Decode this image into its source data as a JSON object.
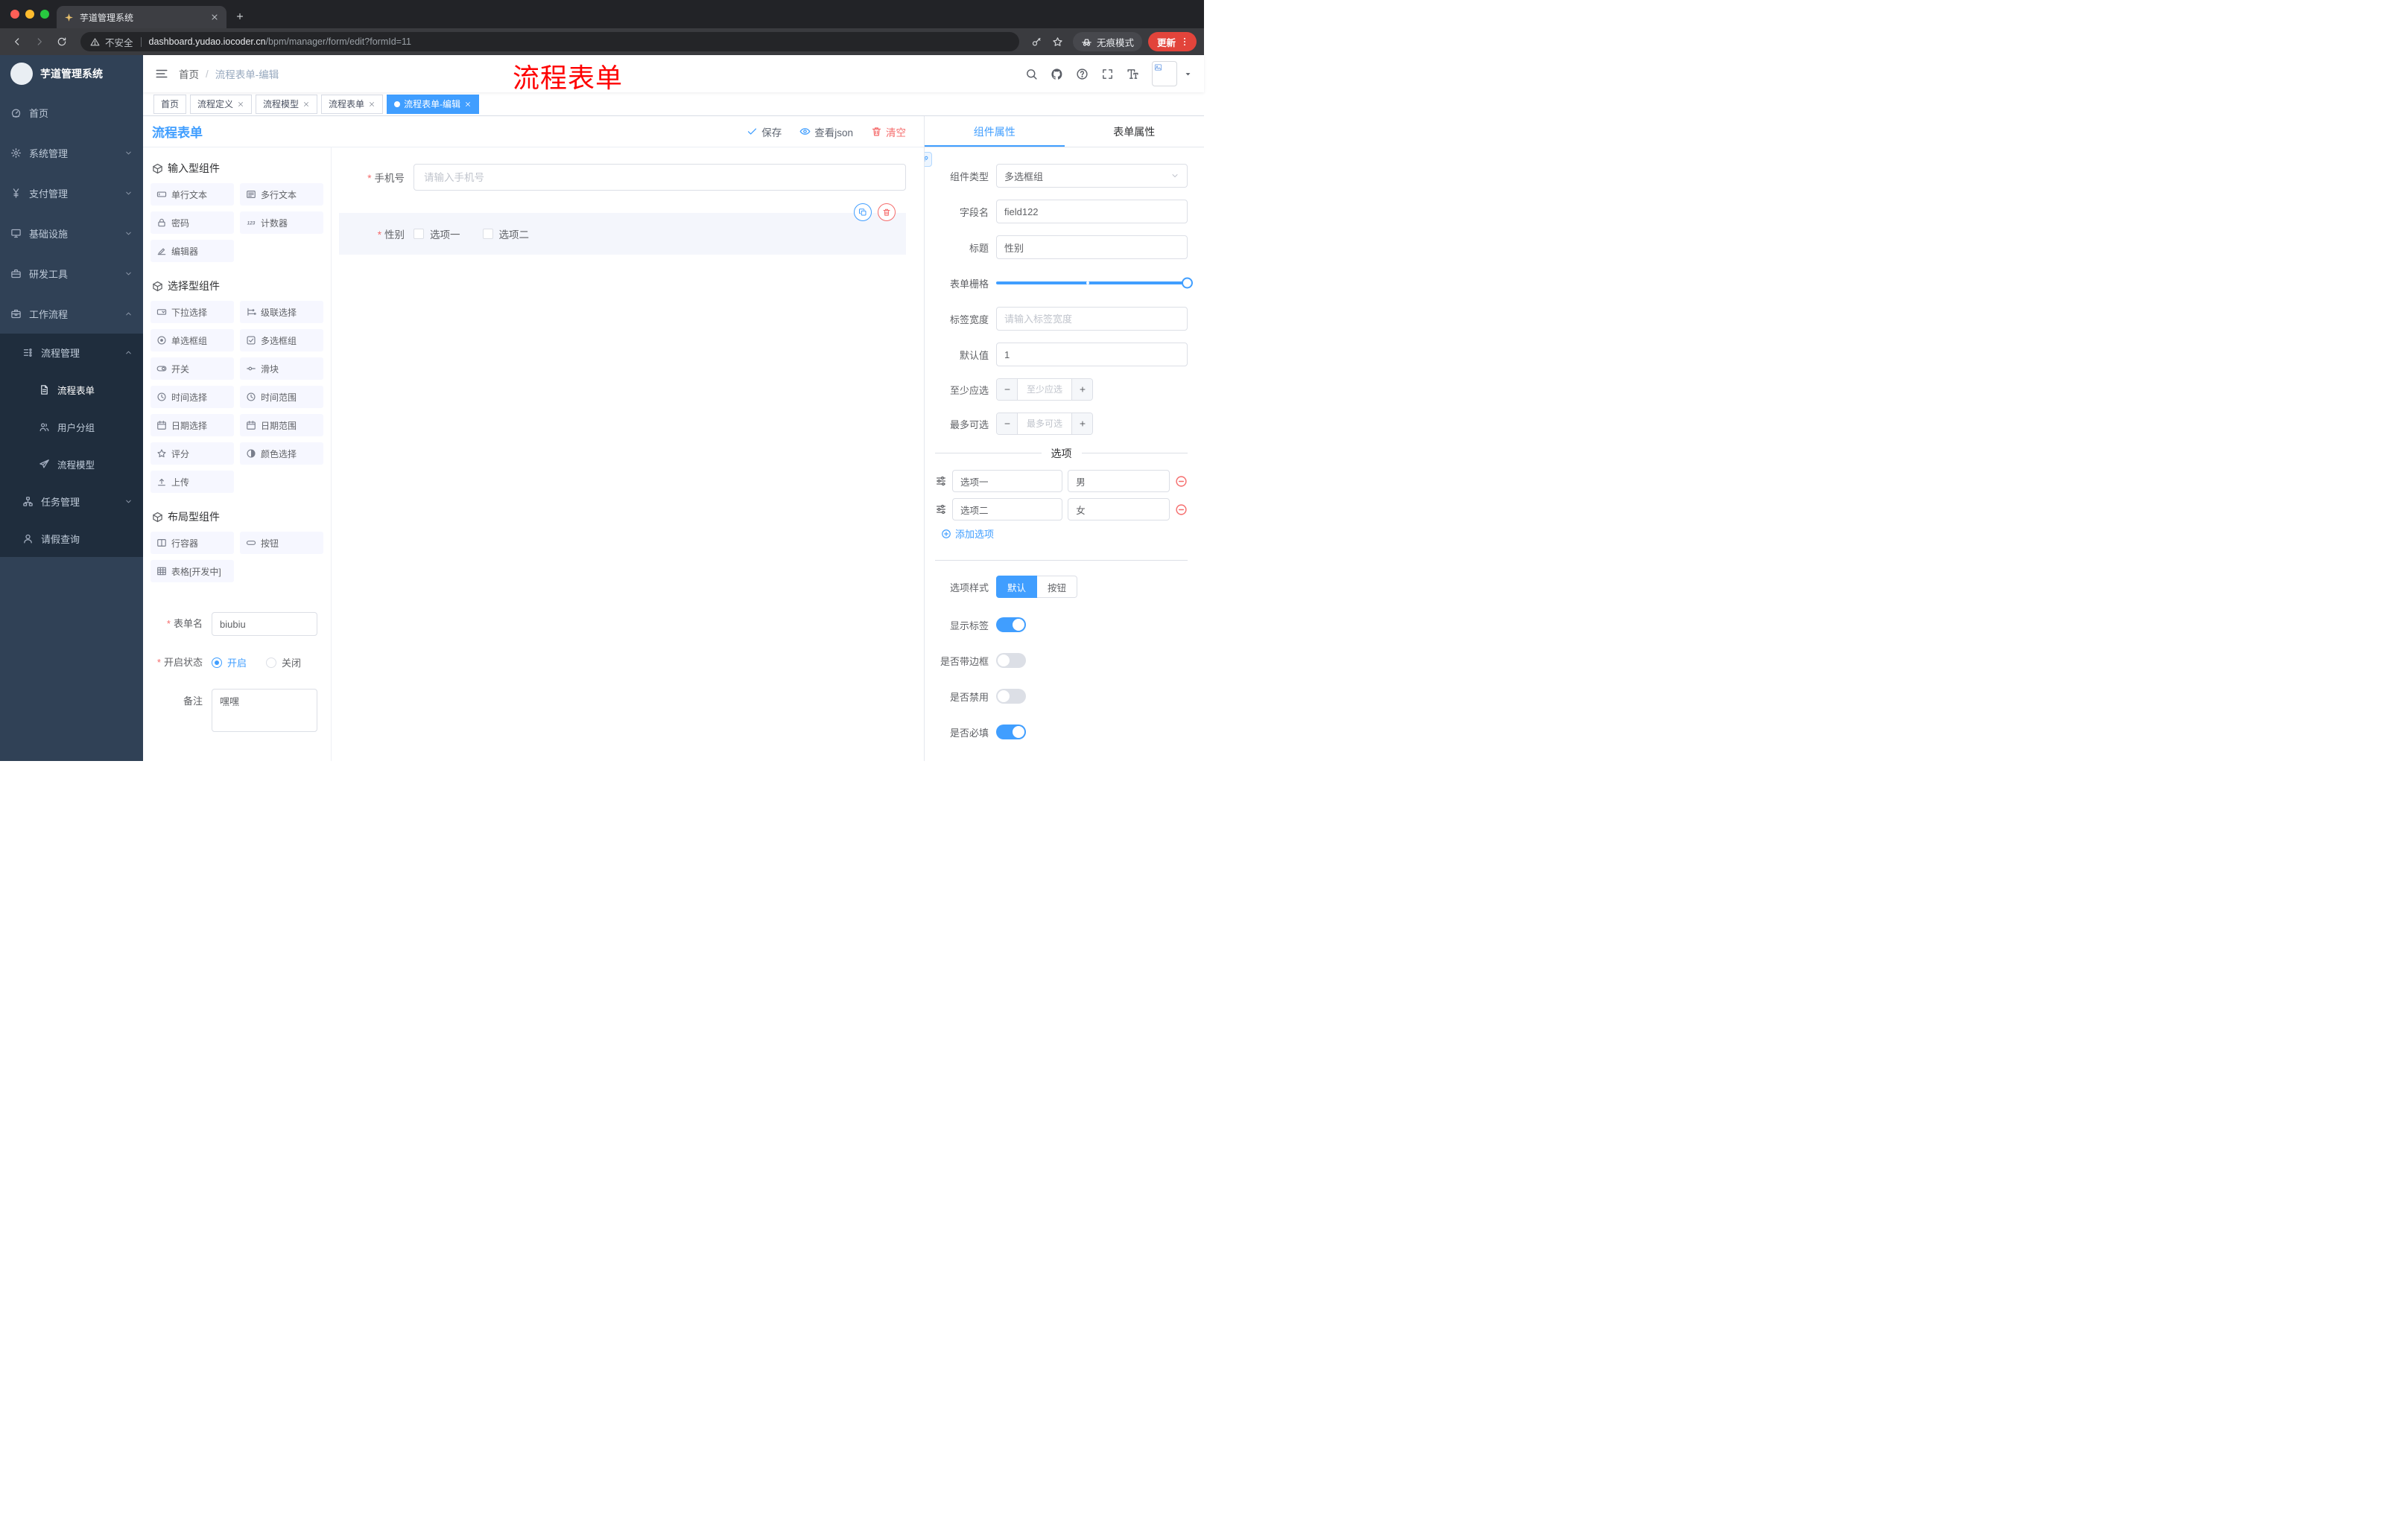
{
  "theme": {
    "primary": "#409eff",
    "danger": "#f56c6c",
    "active_tag": "#409eff",
    "annotation_color": "#ff0000",
    "sidebar_bg": "#304156",
    "submenu_bg": "#1f2d3d"
  },
  "browser": {
    "tab_title": "芋道管理系统",
    "url_security": "不安全",
    "url_host": "dashboard.yudao.iocoder.cn",
    "url_path": "/bpm/manager/form/edit?formId=11",
    "incognito_label": "无痕模式",
    "update_label": "更新",
    "icons": [
      "back",
      "forward",
      "reload",
      "warning",
      "key",
      "star",
      "incognito",
      "kebab-menu"
    ]
  },
  "sidebar": {
    "brand": "芋道管理系统",
    "items": [
      {
        "label": "首页",
        "icon": "dashboard",
        "level": 1
      },
      {
        "label": "系统管理",
        "icon": "gear",
        "level": 1,
        "arrow": "down"
      },
      {
        "label": "支付管理",
        "icon": "yen",
        "level": 1,
        "arrow": "down"
      },
      {
        "label": "基础设施",
        "icon": "monitor",
        "level": 1,
        "arrow": "down"
      },
      {
        "label": "研发工具",
        "icon": "toolbox",
        "level": 1,
        "arrow": "down"
      },
      {
        "label": "工作流程",
        "icon": "briefcase",
        "level": 1,
        "arrow": "up",
        "expanded": true
      },
      {
        "label": "流程管理",
        "icon": "tree",
        "level": 2,
        "arrow": "up",
        "expanded": true
      },
      {
        "label": "流程表单",
        "icon": "document",
        "level": 3,
        "active": true
      },
      {
        "label": "用户分组",
        "icon": "people",
        "level": 3
      },
      {
        "label": "流程模型",
        "icon": "send",
        "level": 3
      },
      {
        "label": "任务管理",
        "icon": "nodes",
        "level": 2,
        "arrow": "down"
      },
      {
        "label": "请假查询",
        "icon": "user",
        "level": 2
      }
    ]
  },
  "header": {
    "breadcrumb": [
      "首页",
      "流程表单-编辑"
    ],
    "breadcrumb_separator": "/",
    "annotation": "流程表单",
    "right_icons": [
      "search",
      "github",
      "help",
      "fullscreen",
      "font-size",
      "avatar",
      "caret-down"
    ]
  },
  "tags": [
    {
      "label": "首页",
      "closable": false,
      "active": false
    },
    {
      "label": "流程定义",
      "closable": true,
      "active": false
    },
    {
      "label": "流程模型",
      "closable": true,
      "active": false
    },
    {
      "label": "流程表单",
      "closable": true,
      "active": false
    },
    {
      "label": "流程表单-编辑",
      "closable": true,
      "active": true
    }
  ],
  "designer": {
    "title": "流程表单",
    "actions": {
      "save": "保存",
      "view_json": "查看json",
      "clear": "清空"
    },
    "palette": {
      "sections": [
        {
          "title": "输入型组件",
          "items": [
            {
              "label": "单行文本",
              "icon": "field-input"
            },
            {
              "label": "多行文本",
              "icon": "field-textarea"
            },
            {
              "label": "密码",
              "icon": "lock"
            },
            {
              "label": "计数器",
              "icon": "number123"
            },
            {
              "label": "编辑器",
              "icon": "pencil"
            }
          ]
        },
        {
          "title": "选择型组件",
          "items": [
            {
              "label": "下拉选择",
              "icon": "select-box"
            },
            {
              "label": "级联选择",
              "icon": "cascader"
            },
            {
              "label": "单选框组",
              "icon": "radio-icon"
            },
            {
              "label": "多选框组",
              "icon": "checkbox-icon"
            },
            {
              "label": "开关",
              "icon": "switch-icon"
            },
            {
              "label": "滑块",
              "icon": "slider-icon"
            },
            {
              "label": "时间选择",
              "icon": "clock"
            },
            {
              "label": "时间范围",
              "icon": "clock"
            },
            {
              "label": "日期选择",
              "icon": "calendar"
            },
            {
              "label": "日期范围",
              "icon": "calendar"
            },
            {
              "label": "评分",
              "icon": "star-o"
            },
            {
              "label": "颜色选择",
              "icon": "color-wheel"
            },
            {
              "label": "上传",
              "icon": "upload"
            }
          ]
        },
        {
          "title": "布局型组件",
          "items": [
            {
              "label": "行容器",
              "icon": "row-layout"
            },
            {
              "label": "按钮",
              "icon": "button-icon"
            },
            {
              "label": "表格[开发中]",
              "icon": "table-grid"
            }
          ]
        }
      ]
    },
    "form_meta": {
      "name_label": "表单名",
      "name_value": "biubiu",
      "status_label": "开启状态",
      "status_options": [
        "开启",
        "关闭"
      ],
      "status_selected": "开启",
      "remark_label": "备注",
      "remark_value": "嘿嘿"
    },
    "canvas": {
      "phone": {
        "label": "手机号",
        "required": true,
        "placeholder": "请输入手机号"
      },
      "gender": {
        "label": "性别",
        "required": true,
        "options": [
          "选项一",
          "选项二"
        ],
        "checked": [
          false,
          false
        ]
      }
    }
  },
  "inspector": {
    "tabs": [
      "组件属性",
      "表单属性"
    ],
    "active_tab": "组件属性",
    "rows": {
      "component_type": {
        "label": "组件类型",
        "value": "多选框组"
      },
      "field_name": {
        "label": "字段名",
        "value": "field122"
      },
      "title": {
        "label": "标题",
        "value": "性别"
      },
      "grid": {
        "label": "表单栅格"
      },
      "label_width": {
        "label": "标签宽度",
        "placeholder": "请输入标签宽度"
      },
      "default_value": {
        "label": "默认值",
        "value": "1"
      },
      "min_select": {
        "label": "至少应选",
        "placeholder": "至少应选"
      },
      "max_select": {
        "label": "最多可选",
        "placeholder": "最多可选"
      }
    },
    "options_divider": "选项",
    "options": [
      {
        "label": "选项一",
        "value": "男"
      },
      {
        "label": "选项二",
        "value": "女"
      }
    ],
    "add_option": "添加选项",
    "style_row": {
      "label": "选项样式",
      "options": [
        "默认",
        "按钮"
      ],
      "selected": "默认"
    },
    "switches": [
      {
        "label": "显示标签",
        "on": true
      },
      {
        "label": "是否带边框",
        "on": false
      },
      {
        "label": "是否禁用",
        "on": false
      },
      {
        "label": "是否必填",
        "on": true
      }
    ]
  }
}
